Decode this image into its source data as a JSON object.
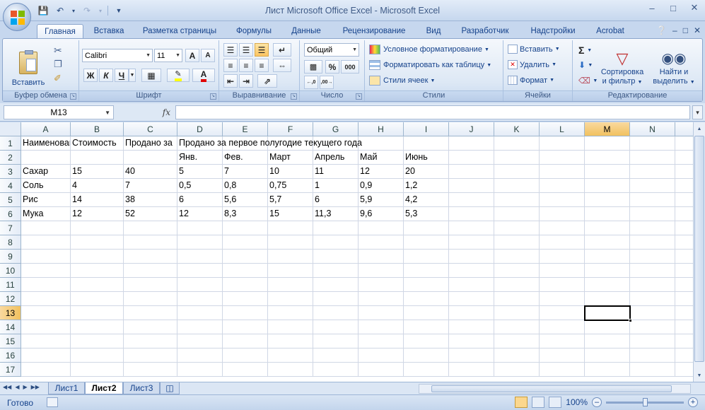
{
  "window": {
    "title": "Лист Microsoft Office Excel - Microsoft Excel"
  },
  "ribbon": {
    "tabs": [
      "Главная",
      "Вставка",
      "Разметка страницы",
      "Формулы",
      "Данные",
      "Рецензирование",
      "Вид",
      "Разработчик",
      "Надстройки",
      "Acrobat"
    ],
    "active_tab": "Главная",
    "clipboard": {
      "paste": "Вставить",
      "label": "Буфер обмена"
    },
    "font": {
      "name": "Calibri",
      "size": "11",
      "label": "Шрифт",
      "bold": "Ж",
      "italic": "К",
      "underline": "Ч",
      "grow": "A",
      "shrink": "A"
    },
    "alignment": {
      "label": "Выравнивание"
    },
    "number": {
      "format": "Общий",
      "percent": "%",
      "thousands": "000",
      "label": "Число"
    },
    "styles": {
      "conditional": "Условное форматирование",
      "as_table": "Форматировать как таблицу",
      "cell_styles": "Стили ячеек",
      "label": "Стили"
    },
    "cells": {
      "insert": "Вставить",
      "delete": "Удалить",
      "format": "Формат",
      "label": "Ячейки"
    },
    "editing": {
      "sum": "Σ",
      "sort_line1": "Сортировка",
      "sort_line2": "и фильтр",
      "find_line1": "Найти и",
      "find_line2": "выделить",
      "label": "Редактирование"
    }
  },
  "formula_bar": {
    "name_box": "M13",
    "fx": "fx",
    "value": ""
  },
  "sheet": {
    "columns": [
      "A",
      "B",
      "C",
      "D",
      "E",
      "F",
      "G",
      "H",
      "I",
      "J",
      "K",
      "L",
      "M",
      "N"
    ],
    "rows": [
      "1",
      "2",
      "3",
      "4",
      "5",
      "6",
      "7",
      "8",
      "9",
      "10",
      "11",
      "12",
      "13",
      "14",
      "15",
      "16",
      "17"
    ],
    "selected_cell": "M13",
    "cells": {
      "A1": "Наименование",
      "B1": "Стоимость",
      "C1": "Продано за",
      "D1": "Продано за первое полугодие текущего года",
      "D2": "Янв.",
      "E2": "Фев.",
      "F2": "Март",
      "G2": "Апрель",
      "H2": "Май",
      "I2": "Июнь",
      "A3": "Сахар",
      "B3": "15",
      "C3": "40",
      "D3": "5",
      "E3": "7",
      "F3": "10",
      "G3": "11",
      "H3": "12",
      "I3": "20",
      "A4": "Соль",
      "B4": "4",
      "C4": "7",
      "D4": "0,5",
      "E4": "0,8",
      "F4": "0,75",
      "G4": "1",
      "H4": "0,9",
      "I4": "1,2",
      "A5": "Рис",
      "B5": "14",
      "C5": "38",
      "D5": "6",
      "E5": "5,6",
      "F5": "5,7",
      "G5": "6",
      "H5": "5,9",
      "I5": "4,2",
      "A6": "Мука",
      "B6": "12",
      "C6": "52",
      "D6": "12",
      "E6": "8,3",
      "F6": "15",
      "G6": "11,3",
      "H6": "9,6",
      "I6": "5,3"
    }
  },
  "sheet_tabs": {
    "items": [
      "Лист1",
      "Лист2",
      "Лист3"
    ],
    "active": "Лист2"
  },
  "status": {
    "ready": "Готово",
    "zoom": "100%"
  },
  "colors": {
    "accent": "#15428b",
    "selected_header": "#f1c15f",
    "gridline": "#d0d7e5"
  }
}
